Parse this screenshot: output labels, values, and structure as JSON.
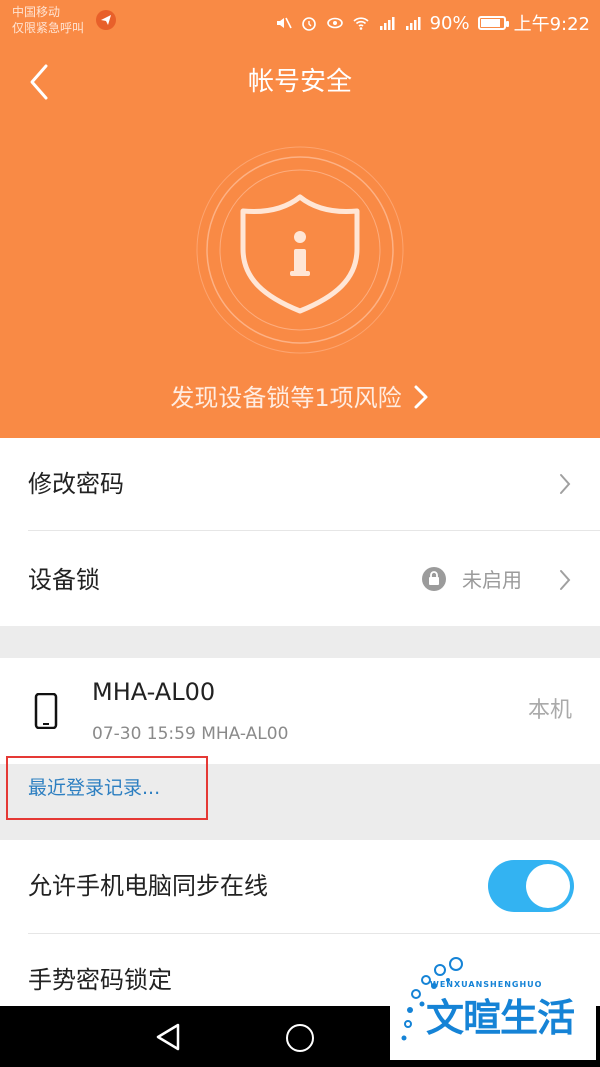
{
  "status_bar": {
    "carrier_line1": "中国移动",
    "carrier_line2": "仅限紧急呼叫",
    "battery": "90%",
    "time": "上午9:22"
  },
  "header": {
    "title": "帐号安全",
    "risk_text": "发现设备锁等1项风险",
    "bg_color": "#f98a45",
    "icon": "shield-info-icon"
  },
  "settings": {
    "change_password": "修改密码",
    "device_lock_label": "设备锁",
    "device_lock_status": "未启用",
    "sync_online": "允许手机电脑同步在线",
    "gesture_lock": "手势密码锁定"
  },
  "device": {
    "name": "MHA-AL00",
    "last_login": "07-30 15:59 MHA-AL00",
    "tag": "本机",
    "icon": "phone-icon"
  },
  "recent_login": "最近登录记录...",
  "toggle": {
    "on": true,
    "color": "#33b3f2"
  },
  "watermark": {
    "small": "WENXUANSHENGHUO",
    "big": "文暄生活"
  }
}
